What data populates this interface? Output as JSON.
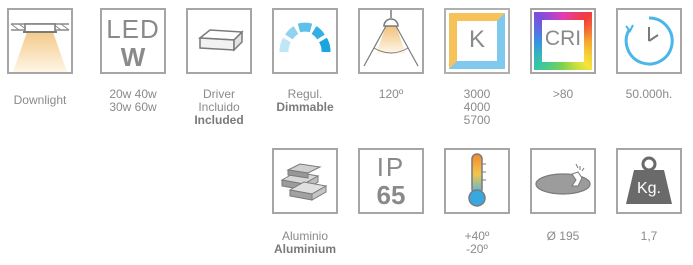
{
  "row1": {
    "downlight": {
      "icon": "downlight-icon",
      "caption": "Downlight"
    },
    "power": {
      "top": "LED",
      "bottom": "W",
      "caption_lines": [
        "20w  40w",
        "30w  60w"
      ]
    },
    "driver": {
      "icon": "driver-icon",
      "caption_lines": [
        "Driver",
        "Incluido"
      ],
      "caption_bold": "Included"
    },
    "regulation": {
      "icon": "dimmable-icon",
      "caption": "Regul.",
      "caption_bold": "Dimmable"
    },
    "beam": {
      "icon": "beam-angle-icon",
      "caption": "120º"
    },
    "color_temp": {
      "letter": "K",
      "caption_lines": [
        "3000",
        "4000",
        "5700"
      ]
    },
    "cri": {
      "letters": "CRI",
      "caption": ">80"
    },
    "lifetime": {
      "icon": "clock-icon",
      "caption": "50.000h."
    }
  },
  "row2": {
    "material": {
      "icon": "aluminium-bars-icon",
      "caption": "Aluminio",
      "caption_bold": "Aluminium"
    },
    "ip": {
      "top": "IP",
      "bottom": "65"
    },
    "temperature": {
      "icon": "thermometer-icon",
      "caption_lines": [
        "+40º",
        "-20º"
      ]
    },
    "cutout": {
      "icon": "cutout-hole-icon",
      "caption": "Ø 195"
    },
    "weight": {
      "label": "Kg.",
      "caption": "1,7"
    }
  }
}
